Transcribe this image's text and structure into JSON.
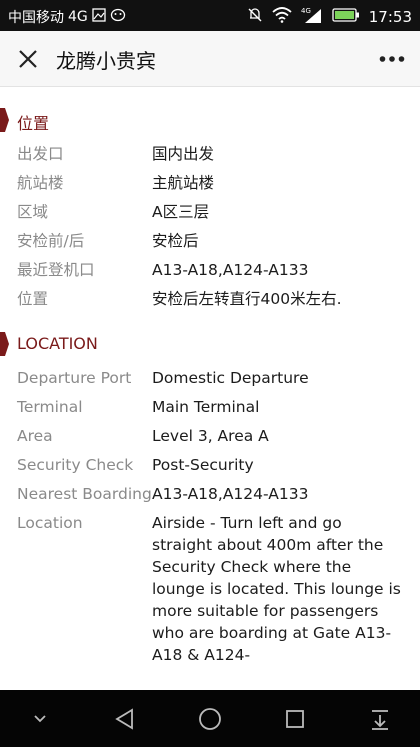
{
  "status_bar": {
    "carrier": "中国移动",
    "network": "4G",
    "time": "17:53",
    "icons": [
      "image-icon",
      "wechat-icon",
      "mute-icon",
      "wifi-icon",
      "signal-4g-icon",
      "battery-icon"
    ]
  },
  "header": {
    "title": "龙腾小贵宾",
    "close_icon": "close-icon",
    "more_icon": "more-dots-icon"
  },
  "sections": {
    "chinese": {
      "title": "位置",
      "rows": [
        {
          "label": "出发口",
          "value": "国内出发"
        },
        {
          "label": "航站楼",
          "value": "主航站楼"
        },
        {
          "label": "区域",
          "value": "A区三层"
        },
        {
          "label": "安检前/后",
          "value": "安检后"
        },
        {
          "label": "最近登机口",
          "value": "A13-A18,A124-A133"
        },
        {
          "label": "位置",
          "value": "安检后左转直行400米左右."
        }
      ]
    },
    "english": {
      "title": "LOCATION",
      "rows": [
        {
          "label": "Departure Port",
          "value": "Domestic Departure"
        },
        {
          "label": "Terminal",
          "value": "Main Terminal"
        },
        {
          "label": "Area",
          "value": "Level 3, Area A"
        },
        {
          "label": "Security Check",
          "value": "Post-Security"
        },
        {
          "label": "Nearest Boarding",
          "value": "A13-A18,A124-A133"
        },
        {
          "label": "Location",
          "value": "Airside - Turn left and go straight about 400m after the Security Check where the lounge is located. This lounge is more suitable for passengers who are boarding at Gate A13-A18 & A124-"
        }
      ]
    }
  },
  "accent_color": "#7a1a1a",
  "nav_bar": {
    "icons": [
      "chevron-down-icon",
      "back-triangle-icon",
      "home-circle-icon",
      "recent-square-icon",
      "notification-pull-icon"
    ]
  }
}
